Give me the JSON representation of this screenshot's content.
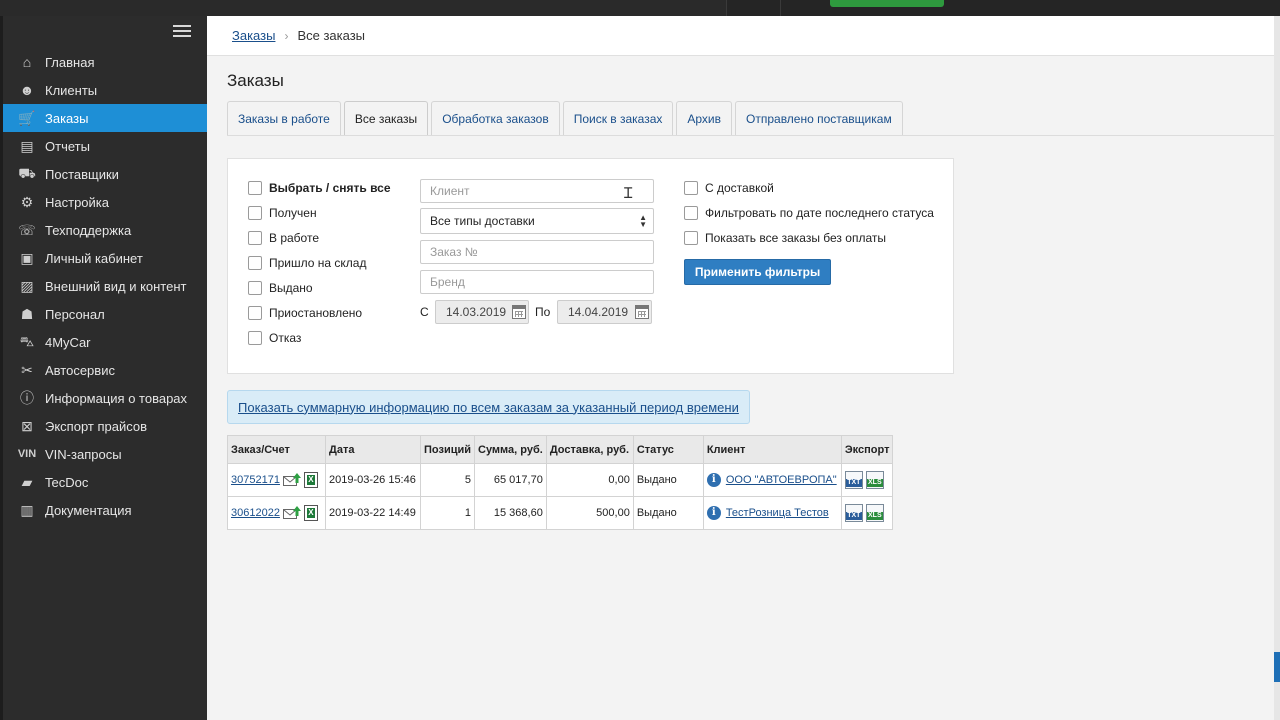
{
  "breadcrumb": {
    "root": "Заказы",
    "current": "Все заказы"
  },
  "page_title": "Заказы",
  "sidebar": {
    "items": [
      {
        "label": "Главная",
        "icon": "home-icon",
        "glyph": "⌂",
        "active": false
      },
      {
        "label": "Клиенты",
        "icon": "user-icon",
        "glyph": "☻",
        "active": false
      },
      {
        "label": "Заказы",
        "icon": "cart-icon",
        "glyph": "🛒",
        "active": true
      },
      {
        "label": "Отчеты",
        "icon": "clipboard-icon",
        "glyph": "▤",
        "active": false
      },
      {
        "label": "Поставщики",
        "icon": "truck-icon",
        "glyph": "⛟",
        "active": false
      },
      {
        "label": "Настройка",
        "icon": "gear-icon",
        "glyph": "⚙",
        "active": false
      },
      {
        "label": "Техподдержка",
        "icon": "support-icon",
        "glyph": "☏",
        "active": false
      },
      {
        "label": "Личный кабинет",
        "icon": "briefcase-icon",
        "glyph": "▣",
        "active": false
      },
      {
        "label": "Внешний вид и контент",
        "icon": "image-icon",
        "glyph": "▨",
        "active": false
      },
      {
        "label": "Персонал",
        "icon": "staff-icon",
        "glyph": "☗",
        "active": false
      },
      {
        "label": "4MyCar",
        "icon": "car-icon",
        "glyph": "⛍",
        "active": false
      },
      {
        "label": "Автосервис",
        "icon": "wrench-icon",
        "glyph": "✂",
        "active": false
      },
      {
        "label": "Информация о товарах",
        "icon": "info-icon",
        "glyph": "ⓘ",
        "active": false
      },
      {
        "label": "Экспорт прайсов",
        "icon": "excel-icon",
        "glyph": "⊠",
        "active": false
      },
      {
        "label": "VIN-запросы",
        "icon": "vin-icon",
        "glyph": "VIN",
        "active": false
      },
      {
        "label": "TecDoc",
        "icon": "folder-icon",
        "glyph": "▰",
        "active": false
      },
      {
        "label": "Документация",
        "icon": "books-icon",
        "glyph": "▥",
        "active": false
      }
    ]
  },
  "tabs": [
    {
      "label": "Заказы в работе",
      "active": false
    },
    {
      "label": "Все заказы",
      "active": true
    },
    {
      "label": "Обработка заказов",
      "active": false
    },
    {
      "label": "Поиск в заказах",
      "active": false
    },
    {
      "label": "Архив",
      "active": false
    },
    {
      "label": "Отправлено поставщикам",
      "active": false
    }
  ],
  "filters": {
    "status_checkboxes": {
      "select_all": "Выбрать / снять все",
      "received": "Получен",
      "in_work": "В работе",
      "arrived": "Пришло на склад",
      "issued": "Выдано",
      "suspended": "Приостановлено",
      "rejected": "Отказ"
    },
    "client_placeholder": "Клиент",
    "delivery_type": "Все типы доставки",
    "order_placeholder": "Заказ №",
    "brand_placeholder": "Бренд",
    "date_from_label": "С",
    "date_from": "14.03.2019",
    "date_to_label": "По",
    "date_to": "14.04.2019",
    "with_delivery": "С доставкой",
    "filter_by_last_status": "Фильтровать по дате последнего статуса",
    "show_unpaid": "Показать все заказы без оплаты",
    "apply_button": "Применить фильтры"
  },
  "summary_link": "Показать суммарную информацию по всем заказам за указанный период времени",
  "orders_table": {
    "columns": [
      "Заказ/Счет",
      "Дата",
      "Позиций",
      "Сумма, руб.",
      "Доставка, руб.",
      "Статус",
      "Клиент",
      "Экспорт"
    ],
    "rows": [
      {
        "order": "30752171",
        "date": "2019-03-26 15:46",
        "positions": "5",
        "sum": "65 017,70",
        "delivery": "0,00",
        "status": "Выдано",
        "client": "ООО \"АВТОЕВРОПА\""
      },
      {
        "order": "30612022",
        "date": "2019-03-22 14:49",
        "positions": "1",
        "sum": "15 368,60",
        "delivery": "500,00",
        "status": "Выдано",
        "client": "ТестРозница Тестов"
      }
    ],
    "export_labels": {
      "txt": "TXT",
      "xls": "XLS"
    }
  },
  "colors": {
    "sidebar_bg": "#2c2c2c",
    "active_nav": "#1e8fd6",
    "primary_button": "#2f7ec2",
    "link": "#1a4f8b"
  }
}
